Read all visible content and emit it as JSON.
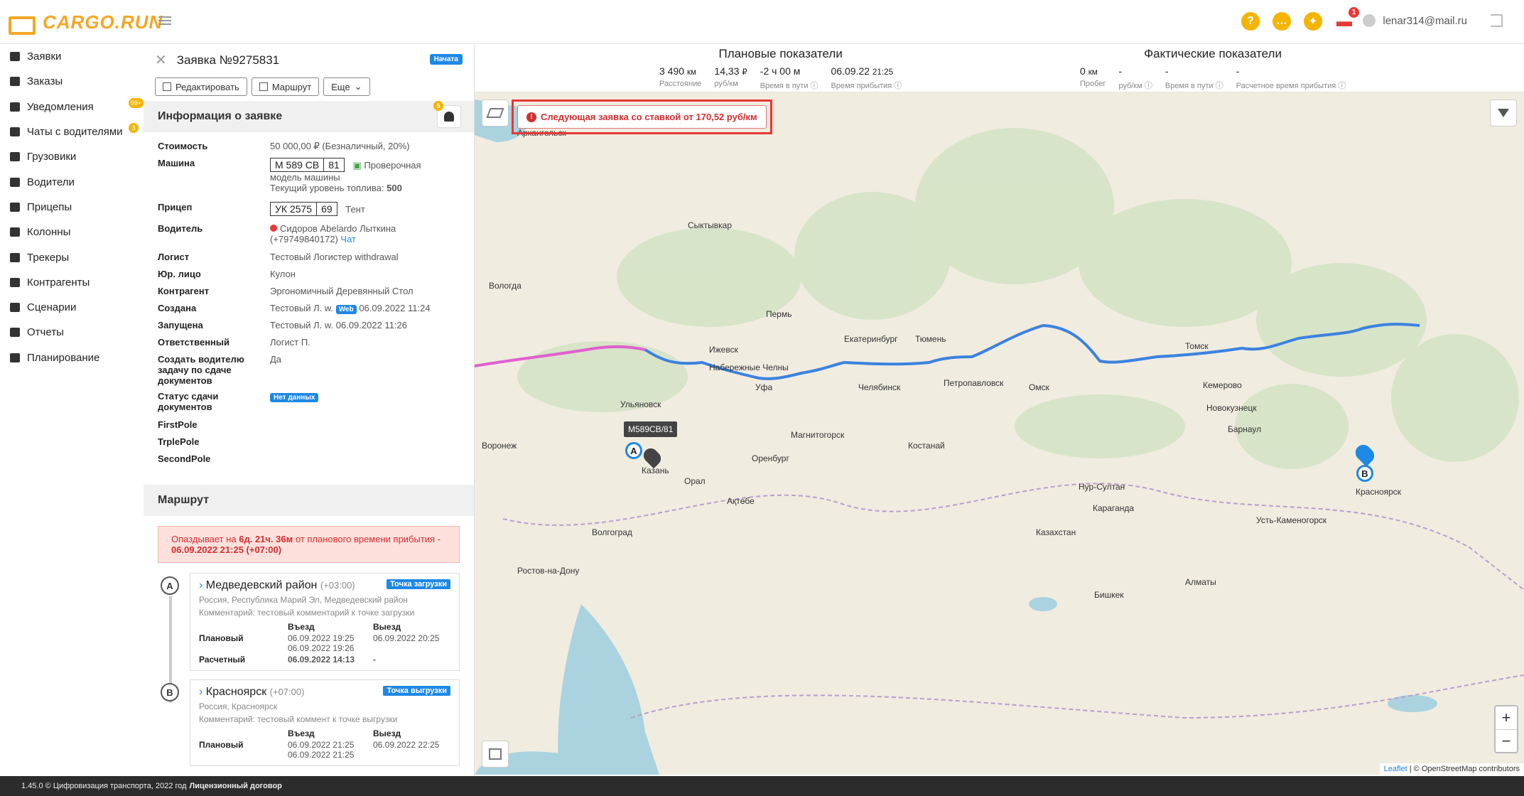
{
  "brand": "CARGO.RUN",
  "top": {
    "help_icon": "?",
    "chat_icon": "…",
    "fire_icon": "🔥",
    "truck_badge": "1",
    "user_email": "lenar314@mail.ru"
  },
  "nav": [
    {
      "label": "Заявки",
      "icon": "orders-icon"
    },
    {
      "label": "Заказы",
      "icon": "cart-icon"
    },
    {
      "label": "Уведомления",
      "icon": "bell-icon",
      "badge": "99+"
    },
    {
      "label": "Чаты с водителями",
      "icon": "chat-icon",
      "badge": "3"
    },
    {
      "label": "Грузовики",
      "icon": "truck-icon"
    },
    {
      "label": "Водители",
      "icon": "driver-icon"
    },
    {
      "label": "Прицепы",
      "icon": "trailer-icon"
    },
    {
      "label": "Колонны",
      "icon": "convoy-icon"
    },
    {
      "label": "Трекеры",
      "icon": "tracker-icon"
    },
    {
      "label": "Контрагенты",
      "icon": "contractor-icon"
    },
    {
      "label": "Сценарии",
      "icon": "scenario-icon"
    },
    {
      "label": "Отчеты",
      "icon": "report-icon"
    },
    {
      "label": "Планирование",
      "icon": "planning-icon"
    }
  ],
  "panel": {
    "title": "Заявка №9275831",
    "status": "Начата",
    "btn_edit": "Редактировать",
    "btn_route": "Маршрут",
    "btn_more": "Еще",
    "info_header": "Информация о заявке",
    "bell_badge": "5",
    "fields": {
      "cost_k": "Стоимость",
      "cost_v": "50 000,00 ₽ (Безналичный, 20%)",
      "car_k": "Машина",
      "car_plate1": "М 589 СВ",
      "car_plate2": "81",
      "car_check": "Проверочная",
      "car_model": "модель машины",
      "fuel_label": "Текущий уровень топлива:",
      "fuel_value": "500",
      "trailer_k": "Прицеп",
      "trailer_plate1": "УК 2575",
      "trailer_plate2": "69",
      "trailer_type": "Тент",
      "driver_k": "Водитель",
      "driver_name": "Сидоров Abelardo Лыткина",
      "driver_phone": "(+79749840172)",
      "driver_chat": "Чат",
      "logist_k": "Логист",
      "logist_v": "Тестовый Логистер withdrawal",
      "legal_k": "Юр. лицо",
      "legal_v": "Кулон",
      "contr_k": "Контрагент",
      "contr_v": "Эргономичный Деревянный Стол",
      "created_k": "Создана",
      "created_who": "Тестовый Л. w.",
      "created_web": "Web",
      "created_at": "06.09.2022 11:24",
      "started_k": "Запущена",
      "started_v": "Тестовый Л. w. 06.09.2022 11:26",
      "resp_k": "Ответственный",
      "resp_v": "Логист П.",
      "task_k": "Создать водителю задачу по сдаче документов",
      "task_v": "Да",
      "docs_k": "Статус сдачи документов",
      "docs_v": "Нет данных",
      "first_k": "FirstPole",
      "trple_k": "TrplePole",
      "second_k": "SecondPole"
    },
    "route_header": "Маршрут",
    "alert_pre": "Опаздывает на",
    "alert_dur": "6д. 21ч. 36м",
    "alert_mid": "от планового времени прибытия -",
    "alert_time": "06.09.2022 21:25 (+07:00)",
    "wp": [
      {
        "letter": "A",
        "name": "Медведевский район",
        "tz": "(+03:00)",
        "tag": "Точка загрузки",
        "addr": "Россия, Республика Марий Эл, Медведевский район",
        "comment": "Комментарий: тестовый комментарий к точке загрузки",
        "h_in": "Въезд",
        "h_out": "Выезд",
        "plan_k": "Плановый",
        "plan_in": "06.09.2022 19:25",
        "plan_out": "06.09.2022 20:25",
        "plan_in2": "06.09.2022 19:26",
        "calc_k": "Расчетный",
        "calc_in": "06.09.2022 14:13",
        "calc_out": "-"
      },
      {
        "letter": "B",
        "name": "Красноярск",
        "tz": "(+07:00)",
        "tag": "Точка выгрузки",
        "addr": "Россия, Красноярск",
        "comment": "Комментарий: тестовый коммент к точке выгрузки",
        "h_in": "Въезд",
        "h_out": "Выезд",
        "plan_k": "Плановый",
        "plan_in": "06.09.2022 21:25",
        "plan_out": "06.09.2022 22:25",
        "plan_in2": "06.09.2022 21:25"
      }
    ]
  },
  "stats": {
    "plan_title": "Плановые показатели",
    "plan": [
      {
        "v": "3 490",
        "u": "км",
        "l": "Расстояние"
      },
      {
        "v": "14,33",
        "u": "₽",
        "l": "руб/км"
      },
      {
        "v": "-2 ч 00 м",
        "u": "",
        "l": "Время в пути ⓘ"
      },
      {
        "v": "06.09.22",
        "u": "21:25",
        "l": "Время прибытия ⓘ"
      }
    ],
    "fact_title": "Фактические показатели",
    "fact": [
      {
        "v": "0",
        "u": "км",
        "l": "Пробег"
      },
      {
        "v": "-",
        "u": "",
        "l": "руб/км ⓘ"
      },
      {
        "v": "-",
        "u": "",
        "l": "Время в пути ⓘ"
      },
      {
        "v": "-",
        "u": "",
        "l": "Расчетное время прибытия ⓘ"
      }
    ]
  },
  "map": {
    "next_order": "Следующая заявка со ставкой от 170,52 руб/км",
    "truck_label": "М589СВ/81",
    "zoom_in": "+",
    "zoom_out": "−",
    "attrib_leaflet": "Leaflet",
    "attrib_osm": "© OpenStreetMap contributors",
    "labels": [
      "Архангельск",
      "Сыктывкар",
      "Вологда",
      "Пермь",
      "Екатеринбург",
      "Тюмень",
      "Томск",
      "Ижевск",
      "Набережные Челны",
      "Уфа",
      "Челябинск",
      "Петропавловск",
      "Омск",
      "Кемерово",
      "Новокузнецк",
      "Барнаул",
      "Магнитогорск",
      "Костанай",
      "Оренбург",
      "Ульяновск",
      "Воронеж",
      "Орал",
      "Ақтөбе",
      "Нур-Султан",
      "Караганда",
      "Усть-Каменогорск",
      "Волгоград",
      "Казахстан",
      "Алматы",
      "Бишкек",
      "Ростов-на-Дону",
      "Красноярск",
      "Казань"
    ]
  },
  "footer": {
    "text": "1.45.0 © Цифровизация транспорта, 2022 год",
    "link": "Лицензионный договор"
  }
}
